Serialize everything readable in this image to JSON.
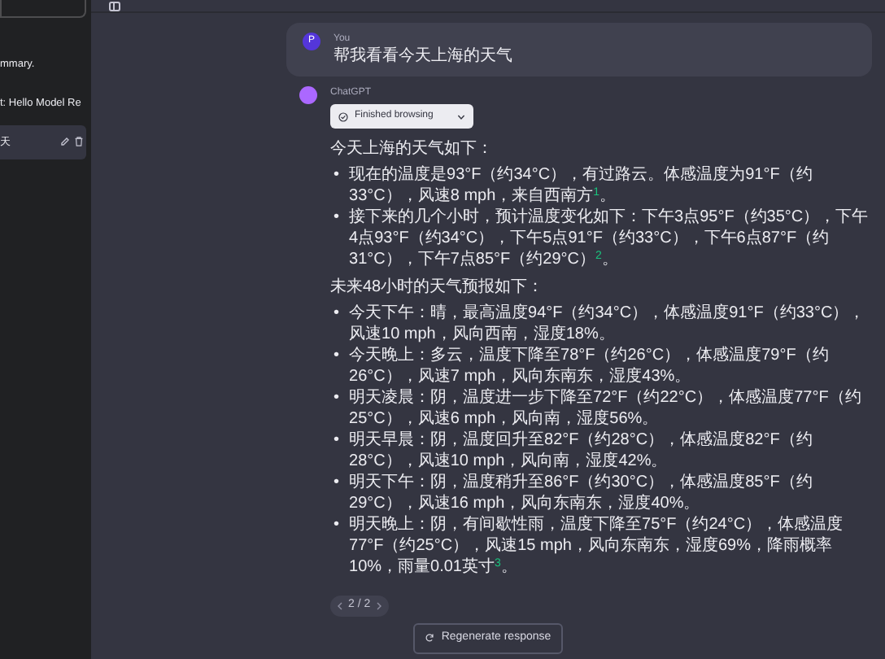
{
  "sidebar": {
    "items": [
      {
        "label": "mmary.",
        "selected": false
      },
      {
        "label": "t: Hello Model Re",
        "selected": false
      },
      {
        "label": "天",
        "selected": true
      }
    ]
  },
  "conversation": [
    {
      "kind": "user",
      "author": "You",
      "avatar": "P",
      "text": "帮我看看今天上海的天气"
    },
    {
      "kind": "assistant",
      "author": "ChatGPT",
      "browsing": "Finished browsing",
      "blocks": [
        {
          "kind": "paragraph",
          "text": "今天上海的天气如下："
        },
        {
          "kind": "list",
          "marker": "•",
          "items": [
            "现在的温度是93°F（约34°C），有过路云。体感温度为91°F（约33°C），风速8 mph，来自西南方$^{1}$。",
            "接下来的几个小时，预计温度变化如下：下午3点95°F（约35°C），下午4点93°F（约34°C），下午5点91°F（约33°C），下午6点87°F（约31°C），下午7点85°F（约29°C）$^{2}$。"
          ]
        },
        {
          "kind": "paragraph",
          "text": "未来48小时的天气预报如下："
        },
        {
          "kind": "list",
          "marker": "•",
          "items": [
            "今天下午：晴，最高温度94°F（约34°C），体感温度91°F（约33°C），风速10 mph，风向西南，湿度18%。",
            "今天晚上：多云，温度下降至78°F（约26°C），体感温度79°F（约26°C），风速7 mph，风向东南东，湿度43%。",
            "明天凌晨：阴，温度进一步下降至72°F（约22°C），体感温度77°F（约25°C），风速6 mph，风向南，湿度56%。",
            "明天早晨：阴，温度回升至82°F（约28°C），体感温度82°F（约28°C），风速10 mph，风向南，湿度42%。",
            "明天下午：阴，温度稍升至86°F（约30°C），体感温度85°F（约29°C），风速16 mph，风向东南东，湿度40%。",
            "明天晚上：阴，有间歇性雨，温度下降至75°F（约24°C），体感温度77°F（约25°C），风速15 mph，风向东南东，湿度69%，降雨概率10%，雨量0.01英寸$^{3}$。"
          ]
        }
      ],
      "pager": "2 / 2"
    }
  ],
  "regenerate_button": "Regenerate response"
}
